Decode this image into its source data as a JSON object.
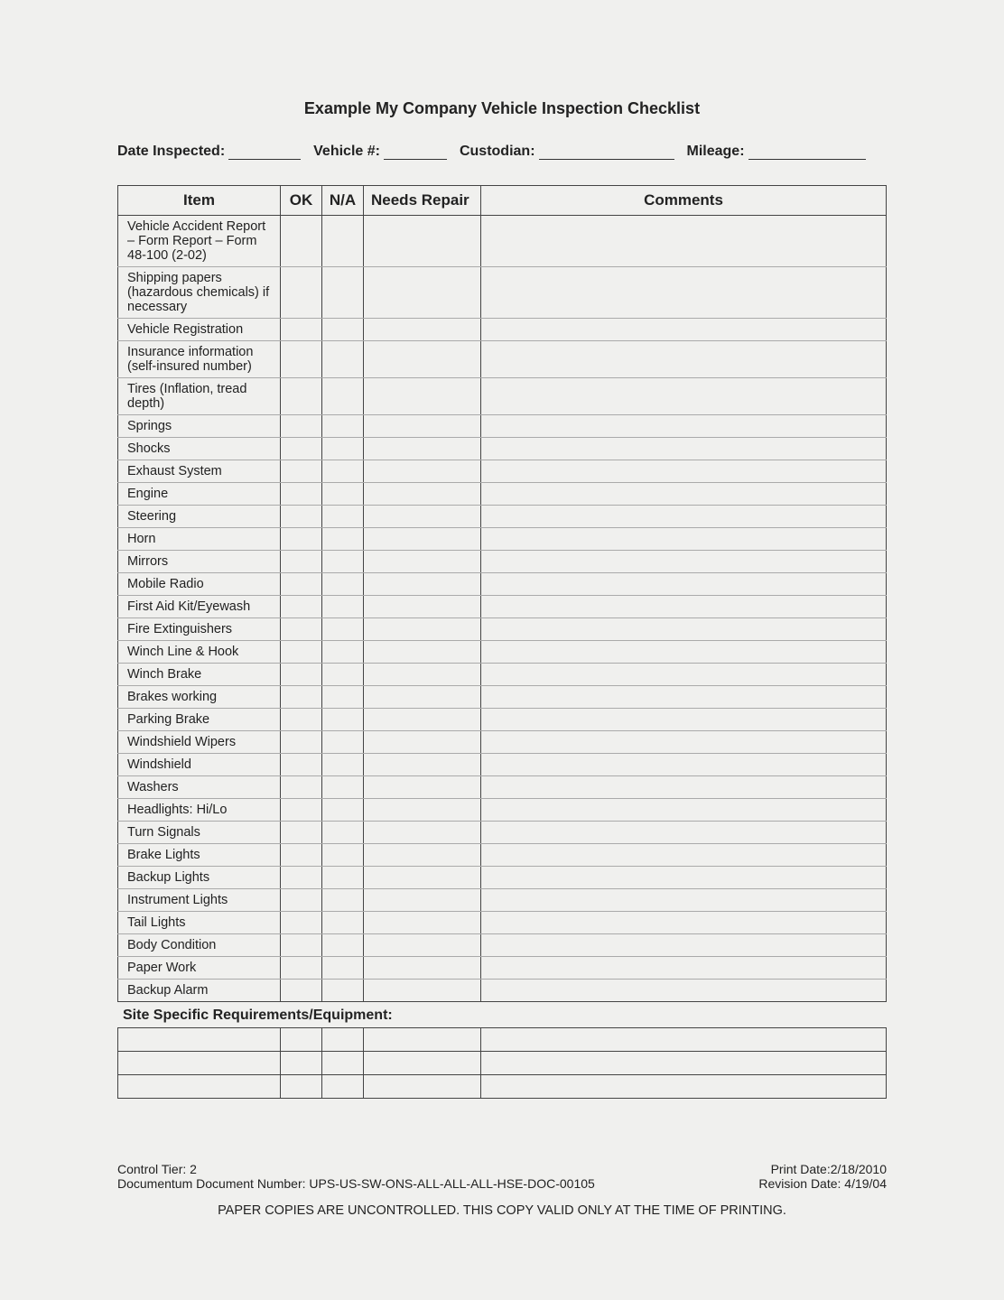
{
  "title": "Example My Company Vehicle Inspection Checklist",
  "meta": {
    "date_label": "Date Inspected:",
    "vehicle_label": "Vehicle #:",
    "custodian_label": "Custodian:",
    "mileage_label": "Mileage:"
  },
  "columns": {
    "item": "Item",
    "ok": "OK",
    "na": "N/A",
    "needs_repair": "Needs Repair",
    "comments": "Comments"
  },
  "rows": [
    "Vehicle Accident Report – Form  Report – Form 48-100 (2-02)",
    "Shipping papers (hazardous chemicals) if necessary",
    "Vehicle Registration",
    "Insurance information (self-insured number)",
    "Tires (Inflation, tread depth)",
    "Springs",
    "Shocks",
    "Exhaust System",
    "Engine",
    "Steering",
    "Horn",
    "Mirrors",
    "Mobile Radio",
    "First Aid Kit/Eyewash",
    "Fire Extinguishers",
    "Winch Line & Hook",
    "Winch Brake",
    "Brakes working",
    "Parking Brake",
    "Windshield Wipers",
    "Windshield",
    "Washers",
    "Headlights: Hi/Lo",
    "Turn Signals",
    "Brake Lights",
    "Backup Lights",
    "Instrument Lights",
    "Tail Lights",
    "Body Condition",
    "Paper Work",
    "Backup Alarm"
  ],
  "section_label": "Site Specific Requirements/Equipment:",
  "extra_row_count": 3,
  "footer": {
    "control_tier": "Control Tier: 2",
    "doc_number": "Documentum Document Number: UPS-US-SW-ONS-ALL-ALL-ALL-HSE-DOC-00105",
    "print_date": "Print Date:2/18/2010",
    "revision_date": "Revision Date: 4/19/04",
    "note": "PAPER COPIES ARE UNCONTROLLED.  THIS COPY VALID ONLY AT THE TIME OF PRINTING."
  }
}
